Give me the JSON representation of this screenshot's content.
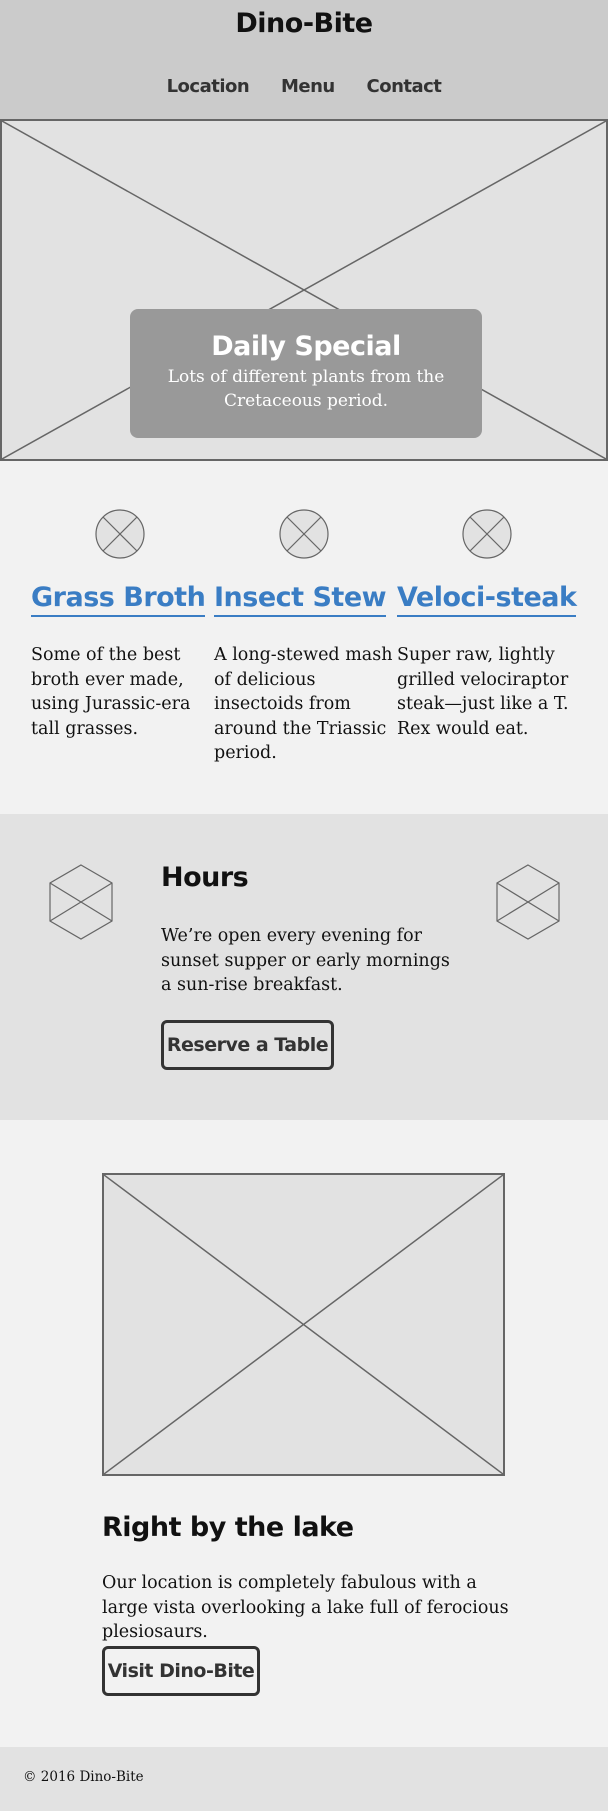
{
  "header": {
    "logo": "Dino-Bite",
    "nav": [
      "Location",
      "Menu",
      "Contact"
    ]
  },
  "hero": {
    "title": "Daily Special",
    "text": "Lots of different plants from the Cretaceous period."
  },
  "menu": {
    "items": [
      {
        "title": "Grass Broth",
        "text": "Some of the best broth ever made, using Jurassic-era tall grasses."
      },
      {
        "title": "Insect Stew",
        "text": "A long-stewed mash of delicious insectoids from around the Triassic period."
      },
      {
        "title": "Veloci-steak",
        "text": "Super raw, lightly grilled velociraptor steak—just like a T. Rex would eat."
      }
    ]
  },
  "hours": {
    "title": "Hours",
    "text": "We’re open every evening for sunset supper or early mornings a sun-rise breakfast.",
    "button": "Reserve a Table"
  },
  "location": {
    "title": "Right by the lake",
    "text": "Our location is completely fabulous with a large vista overlooking a lake full of ferocious plesiosaurs.",
    "button": "Visit Dino-Bite"
  },
  "footer": {
    "text": "© 2016 Dino-Bite"
  },
  "colors": {
    "header_bg": "#cbcbcb",
    "page_bg": "#f2f2f2",
    "section_bg": "#e2e2e2",
    "accent_link": "#3a7dc4",
    "special_box": "#999999"
  },
  "icons": {
    "placeholder_image": "image-placeholder-icon",
    "menu_icon": "circle-x-icon",
    "hours_icon": "hexagon-icon"
  }
}
